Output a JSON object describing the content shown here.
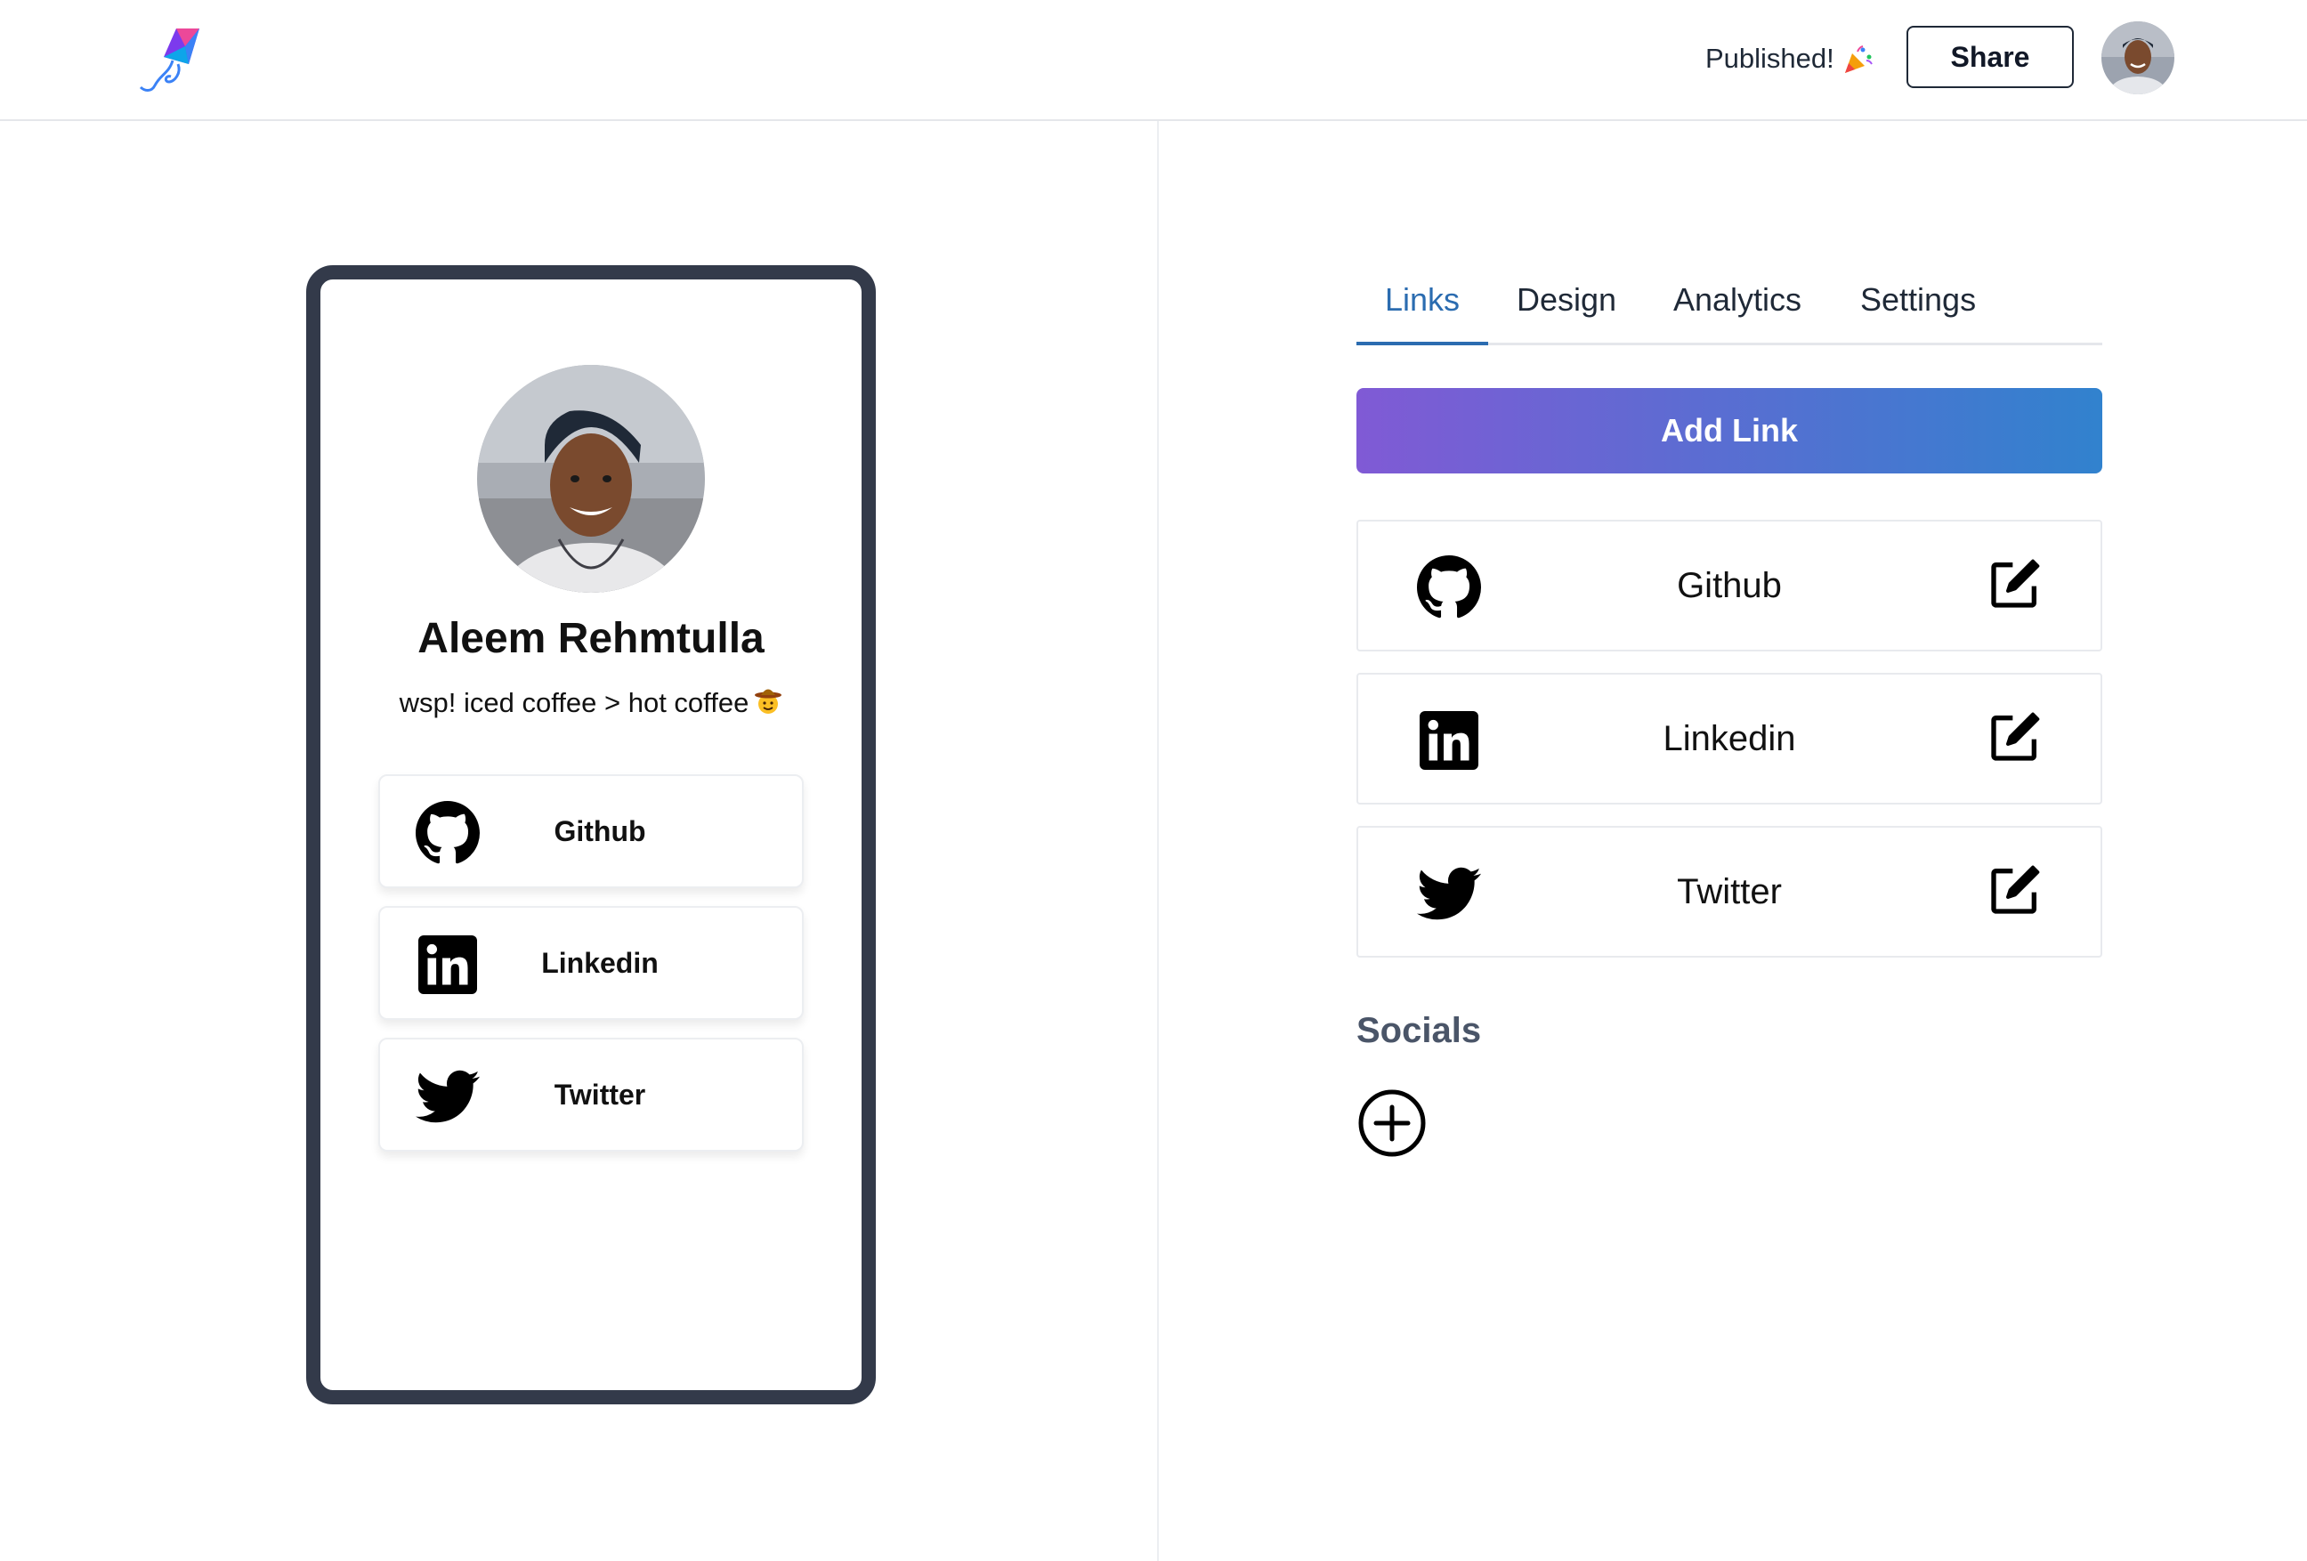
{
  "header": {
    "logo_icon": "kite-logo-icon",
    "status_text": "Published!",
    "status_emoji": "party-popper-icon",
    "share_label": "Share",
    "avatar": "user-avatar"
  },
  "preview": {
    "name": "Aleem Rehmtulla",
    "bio": "wsp! iced coffee > hot coffee",
    "bio_emoji": "cowboy-face-icon",
    "links": [
      {
        "label": "Github",
        "icon": "github-icon"
      },
      {
        "label": "Linkedin",
        "icon": "linkedin-icon"
      },
      {
        "label": "Twitter",
        "icon": "twitter-icon"
      }
    ]
  },
  "editor": {
    "tabs": [
      {
        "label": "Links",
        "active": true
      },
      {
        "label": "Design",
        "active": false
      },
      {
        "label": "Analytics",
        "active": false
      },
      {
        "label": "Settings",
        "active": false
      }
    ],
    "add_link_label": "Add Link",
    "links": [
      {
        "label": "Github",
        "icon": "github-icon",
        "action_icon": "edit-icon"
      },
      {
        "label": "Linkedin",
        "icon": "linkedin-icon",
        "action_icon": "edit-icon"
      },
      {
        "label": "Twitter",
        "icon": "twitter-icon",
        "action_icon": "edit-icon"
      }
    ],
    "socials_title": "Socials",
    "add_social_icon": "plus-circle-icon"
  },
  "colors": {
    "accent_blue": "#2b6cb0",
    "gradient_start": "#805ad5",
    "gradient_end": "#3182ce",
    "phone_frame": "#333a4a"
  }
}
